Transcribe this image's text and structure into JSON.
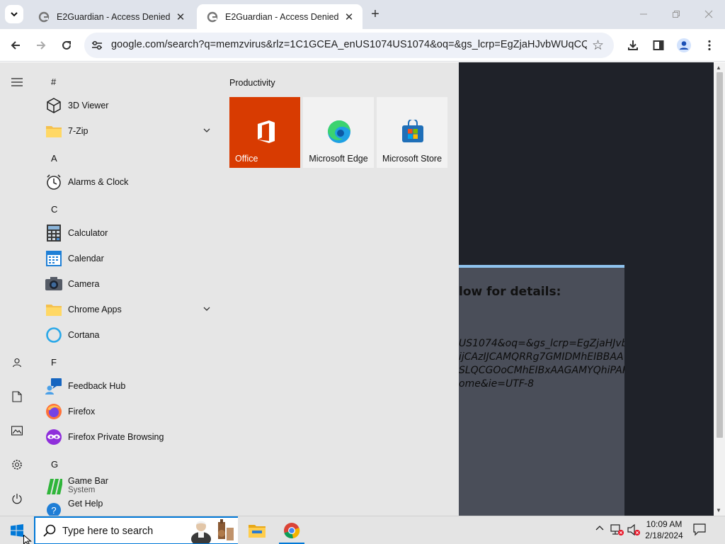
{
  "browser": {
    "tabs": [
      {
        "title": "E2Guardian - Access Denied",
        "active": false
      },
      {
        "title": "E2Guardian - Access Denied",
        "active": true
      }
    ],
    "address": "google.com/search?q=memzvirus&rlz=1C1GCEA_enUS1074US1074&oq=&gs_lcrp=EgZjaHJvbWUqCQgAE..."
  },
  "page": {
    "heading": "low for details:",
    "lines": [
      "US1074&oq=&gs_lcrp=EgZjaHJvb",
      "ijCAzIJCAMQRRg7GMIDMhEIBBAA",
      "SLQCGOoCMhEIBxAAGAMYQhiPAR",
      "ome&ie=UTF-8"
    ]
  },
  "startmenu": {
    "groups": [
      {
        "letter": "#",
        "apps": [
          {
            "label": "3D Viewer",
            "icon": "cube-icon"
          },
          {
            "label": "7-Zip",
            "icon": "folder-icon",
            "expandable": true
          }
        ]
      },
      {
        "letter": "A",
        "apps": [
          {
            "label": "Alarms & Clock",
            "icon": "clock-icon"
          }
        ]
      },
      {
        "letter": "C",
        "apps": [
          {
            "label": "Calculator",
            "icon": "calculator-icon"
          },
          {
            "label": "Calendar",
            "icon": "calendar-icon"
          },
          {
            "label": "Camera",
            "icon": "camera-icon"
          },
          {
            "label": "Chrome Apps",
            "icon": "folder-icon",
            "expandable": true
          },
          {
            "label": "Cortana",
            "icon": "cortana-icon"
          }
        ]
      },
      {
        "letter": "F",
        "apps": [
          {
            "label": "Feedback Hub",
            "icon": "feedback-icon"
          },
          {
            "label": "Firefox",
            "icon": "firefox-icon"
          },
          {
            "label": "Firefox Private Browsing",
            "icon": "firefox-private-icon"
          }
        ]
      },
      {
        "letter": "G",
        "apps": [
          {
            "label": "Game Bar",
            "sub": "System",
            "icon": "gamebar-icon"
          },
          {
            "label": "Get Help",
            "icon": "help-icon"
          }
        ]
      }
    ],
    "tiles_group": "Productivity",
    "tiles": [
      {
        "label": "Office",
        "icon": "office-icon"
      },
      {
        "label": "Microsoft Edge",
        "icon": "edge-icon"
      },
      {
        "label": "Microsoft Store",
        "icon": "store-icon"
      }
    ]
  },
  "taskbar": {
    "search_placeholder": "Type here to search",
    "time": "10:09 AM",
    "date": "2/18/2024"
  },
  "colors": {
    "accent": "#0078d7",
    "office_tile": "#d83b01",
    "startmenu_bg": "#e6e6e6"
  }
}
